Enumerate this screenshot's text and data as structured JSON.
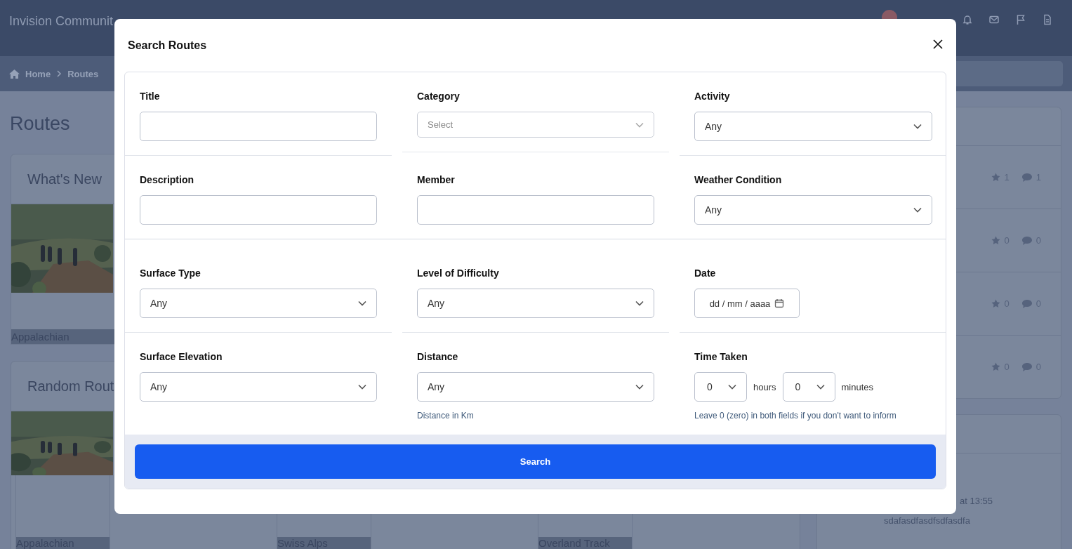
{
  "header": {
    "site_title": "Invision Communit"
  },
  "breadcrumb": [
    {
      "label": "Home"
    },
    {
      "label": "Routes"
    }
  ],
  "page_title": "Routes",
  "feature_cards": [
    {
      "kind": "single",
      "title": "What's New",
      "captions": [
        "Appalachian"
      ]
    },
    {
      "kind": "carousel",
      "title": "Random Rout",
      "captions": [
        "Appalachian",
        "Swiss Alps",
        "Overland Track"
      ]
    }
  ],
  "sidebar_list": [
    {
      "favorites": "1",
      "comments": "1"
    },
    {
      "favorites": "0",
      "comments": "0"
    },
    {
      "favorites": "0",
      "comments": "0"
    },
    {
      "favorites": "0",
      "comments": "0"
    }
  ],
  "sidebar_activity": {
    "time": "at 13:55",
    "excerpt": "sdafasdfasdfsdfasdfa"
  },
  "modal": {
    "title": "Search Routes",
    "groups": [
      [
        {
          "kind": "text",
          "label": "Title"
        },
        {
          "kind": "multiselect",
          "label": "Category",
          "placeholder": "Select"
        },
        {
          "kind": "select",
          "label": "Activity",
          "value": "Any"
        },
        {
          "kind": "text",
          "label": "Description"
        },
        {
          "kind": "text",
          "label": "Member"
        },
        {
          "kind": "select",
          "label": "Weather Condition",
          "value": "Any"
        }
      ],
      [
        {
          "kind": "select",
          "label": "Surface Type",
          "value": "Any"
        },
        {
          "kind": "select",
          "label": "Level of Difficulty",
          "value": "Any"
        },
        {
          "kind": "date",
          "label": "Date",
          "placeholder": "dd / mm / aaaa"
        },
        {
          "kind": "select",
          "label": "Surface Elevation",
          "value": "Any"
        },
        {
          "kind": "select",
          "label": "Distance",
          "value": "Any",
          "hint": "Distance in Km"
        },
        {
          "kind": "duration",
          "label": "Time Taken",
          "parts": [
            {
              "value": "0",
              "unit": "hours"
            },
            {
              "value": "0",
              "unit": "minutes"
            }
          ],
          "hint": "Leave 0 (zero) in both fields if you don't want to inform"
        }
      ]
    ],
    "search_button": "Search"
  }
}
